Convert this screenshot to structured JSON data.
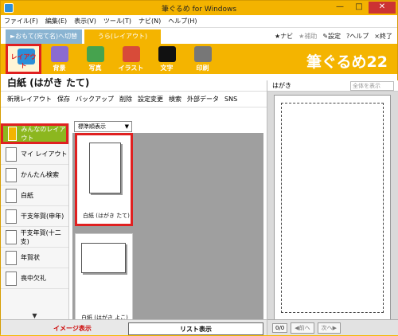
{
  "window": {
    "title": "筆ぐるめ for Windows",
    "minimize": "—",
    "maximize": "□",
    "close": "✕"
  },
  "menu": [
    "ファイル(F)",
    "編集(E)",
    "表示(V)",
    "ツール(T)",
    "ナビ(N)",
    "ヘルプ(H)"
  ],
  "tabs": {
    "switch": "►おもて(宛て名)へ切替",
    "layout": "うら(レイアウト)"
  },
  "tools": {
    "navi": "★ナビ",
    "assist": "★補助",
    "settings": "✎設定",
    "help": "?ヘルプ",
    "exit": "×終了"
  },
  "ribbon": {
    "items": [
      {
        "label": "レイアウト",
        "color": "#2b8fd8"
      },
      {
        "label": "背景",
        "color": "#8b6bd0"
      },
      {
        "label": "写真",
        "color": "#46a34e"
      },
      {
        "label": "イラスト",
        "color": "#d84b39"
      },
      {
        "label": "文字",
        "color": "#111111"
      },
      {
        "label": "印刷",
        "color": "#777777"
      }
    ],
    "brand": "筆ぐるめ22"
  },
  "main": {
    "header": "白紙 (はがき たて)"
  },
  "toolbar": {
    "new_layout": "新規レイアウト",
    "save": "保存",
    "backup": "バックアップ",
    "delete": "削除",
    "settings_change": "設定変更",
    "search": "検索",
    "external": "外部データ",
    "sns": "SNS"
  },
  "sidebar": {
    "items": [
      {
        "label": "みんなのレイアウト"
      },
      {
        "label": "マイ レイアウト"
      },
      {
        "label": "かんたん検索"
      },
      {
        "label": "白紙"
      },
      {
        "label": "干支年賀(申年)"
      },
      {
        "label": "干支年賀(十二支)"
      },
      {
        "label": "年賀状"
      },
      {
        "label": "喪中欠礼"
      }
    ],
    "scroll": "▼"
  },
  "sort": {
    "label": "標準順表示",
    "arrow": "▼"
  },
  "cards": [
    {
      "label": "白紙 (はがき たて)"
    },
    {
      "label": "白紙 (はがき よこ)"
    }
  ],
  "bottom": {
    "image_view": "イメージ表示",
    "list_view": "リスト表示"
  },
  "right": {
    "header": "はがき",
    "zoom": "全体を表示",
    "page": "0/0",
    "prev": "◀前へ",
    "next": "次へ▶"
  }
}
